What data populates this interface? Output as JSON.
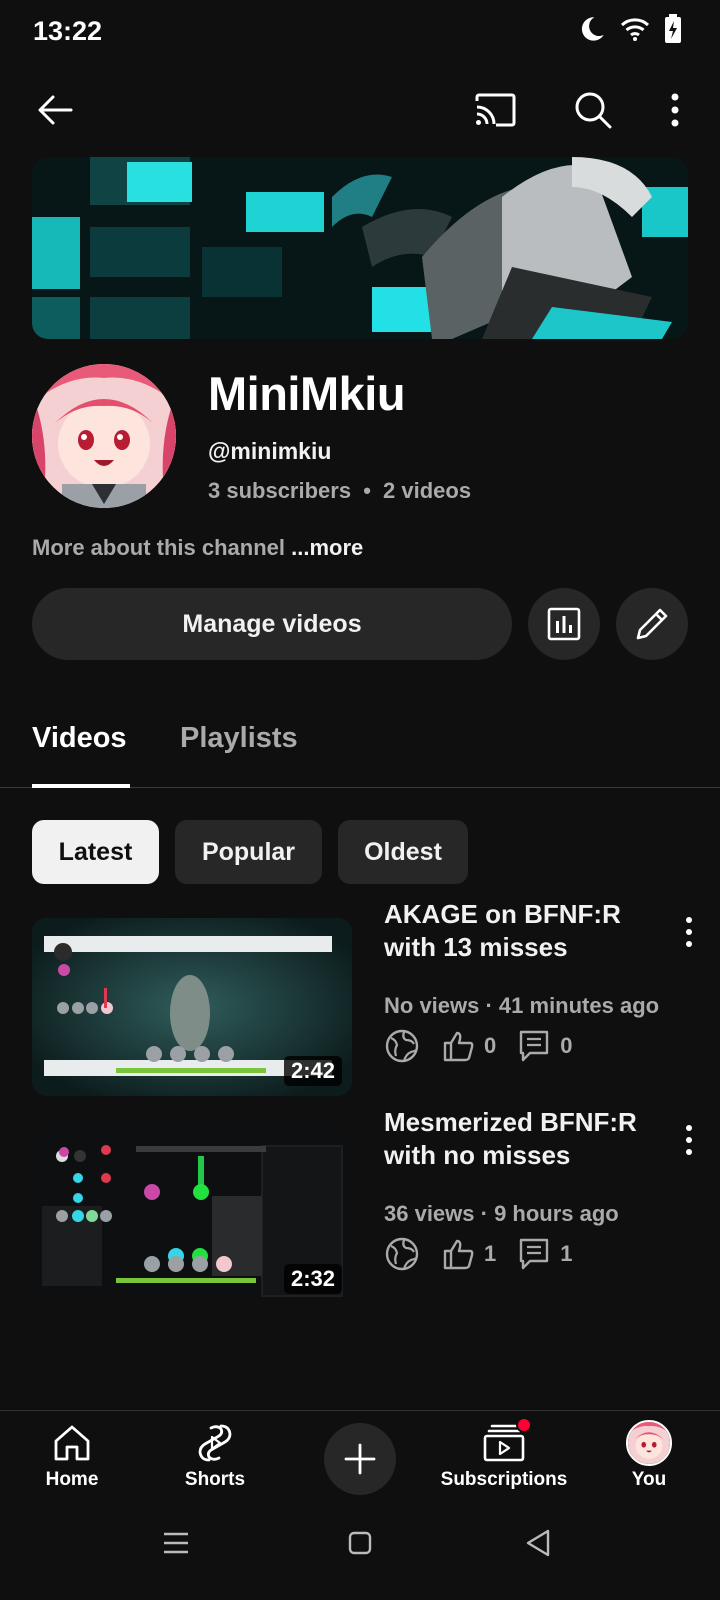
{
  "status_bar": {
    "time": "13:22"
  },
  "channel": {
    "name": "MiniMkiu",
    "handle": "@minimkiu",
    "subscribers": "3 subscribers",
    "separator": "•",
    "videos_count": "2 videos",
    "about_text": "More about this channel",
    "about_more": "...more"
  },
  "actions": {
    "manage_videos": "Manage videos"
  },
  "tabs": [
    {
      "label": "Videos",
      "selected": true
    },
    {
      "label": "Playlists",
      "selected": false
    }
  ],
  "chips": [
    {
      "label": "Latest",
      "selected": true
    },
    {
      "label": "Popular",
      "selected": false
    },
    {
      "label": "Oldest",
      "selected": false
    }
  ],
  "videos": [
    {
      "title_line1": "AKAGE on BFNF:R",
      "title_line2": "with 13 misses",
      "meta": "No views · 41 minutes ago",
      "duration": "2:42",
      "likes": "0",
      "comments": "0",
      "visibility_icon": "globe-icon"
    },
    {
      "title_line1": "Mesmerized BFNF:R",
      "title_line2": "with no misses",
      "meta": "36 views · 9 hours ago",
      "duration": "2:32",
      "likes": "1",
      "comments": "1",
      "visibility_icon": "globe-icon"
    }
  ],
  "bottom_nav": {
    "home": "Home",
    "shorts": "Shorts",
    "subscriptions": "Subscriptions",
    "you": "You"
  },
  "colors": {
    "background": "#0f0f0f",
    "chip_bg": "#272727",
    "chip_selected_bg": "#f1f1f1",
    "secondary_text": "#aaaaaa",
    "notification_dot": "#ff0033",
    "banner_accent": "#00e5e5"
  }
}
